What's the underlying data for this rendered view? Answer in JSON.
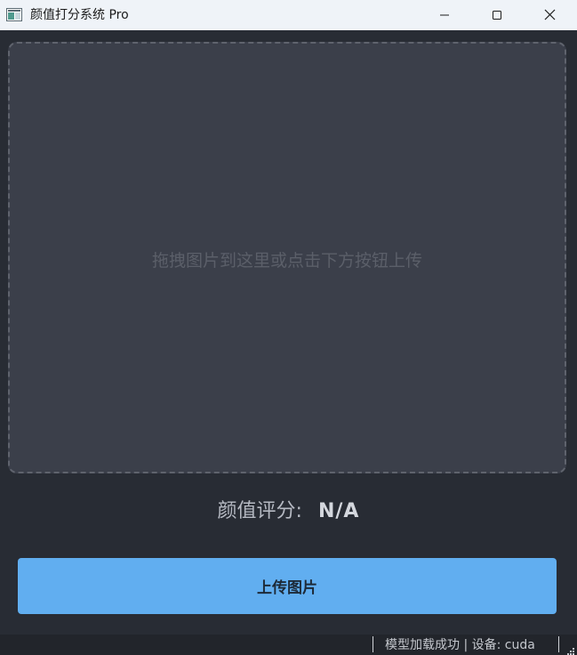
{
  "window": {
    "title": "颜值打分系统 Pro",
    "icon": "app-window-icon",
    "controls": [
      "minimize-icon",
      "maximize-icon",
      "close-icon"
    ]
  },
  "dropzone": {
    "hint": "拖拽图片到这里或点击下方按钮上传"
  },
  "score": {
    "label": "颜值评分:",
    "value": "N/A"
  },
  "upload_button": {
    "label": "上传图片"
  },
  "statusbar": {
    "message": "模型加载成功 | 设备: cuda"
  },
  "colors": {
    "background": "#282c34",
    "dropzone": "#3b3f4a",
    "accent": "#61aef0",
    "titlebar": "#eff3f8"
  }
}
